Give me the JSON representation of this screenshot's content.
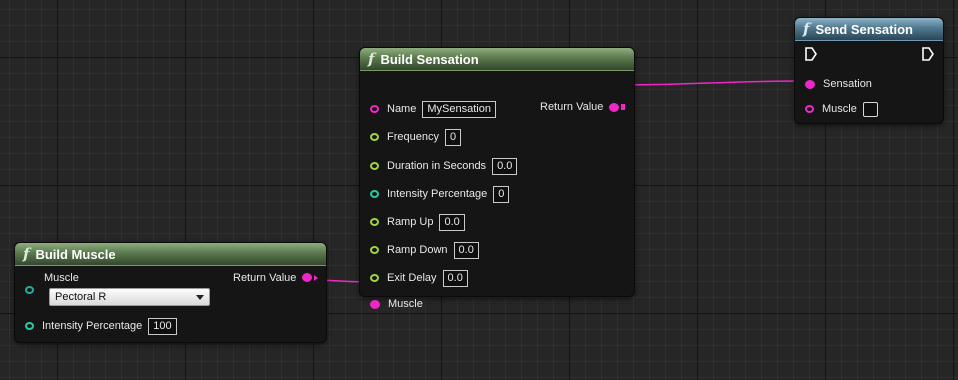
{
  "nodes": {
    "build_sensation": {
      "title": "Build Sensation",
      "return_label": "Return Value",
      "name_label": "Name",
      "name_value": "MySensation",
      "frequency_label": "Frequency",
      "frequency_value": "0",
      "duration_label": "Duration in Seconds",
      "duration_value": "0.0",
      "intensity_label": "Intensity Percentage",
      "intensity_value": "0",
      "rampup_label": "Ramp Up",
      "rampup_value": "0.0",
      "rampdown_label": "Ramp Down",
      "rampdown_value": "0.0",
      "exitdelay_label": "Exit Delay",
      "exitdelay_value": "0.0",
      "muscle_label": "Muscle"
    },
    "send_sensation": {
      "title": "Send Sensation",
      "sensation_label": "Sensation",
      "muscle_label": "Muscle"
    },
    "build_muscle": {
      "title": "Build Muscle",
      "muscle_label": "Muscle",
      "muscle_value": "Pectoral R",
      "return_label": "Return Value",
      "intensity_label": "Intensity Percentage",
      "intensity_value": "100"
    }
  },
  "colors": {
    "struct_pin": "#f027c8",
    "float_pin": "#9ed23e",
    "int_pin": "#27c8a5",
    "function_header": "#5a7a4e",
    "latent_header": "#4f7990"
  }
}
